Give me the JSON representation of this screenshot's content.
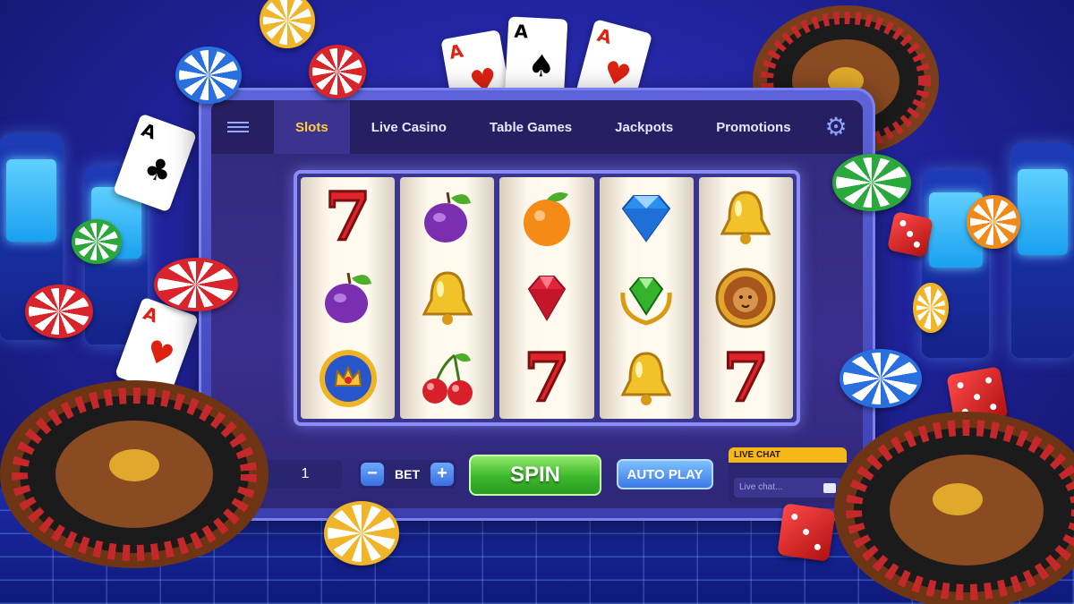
{
  "nav": {
    "menu_icon": "hamburger-menu-icon",
    "tabs": [
      {
        "label": "Slots",
        "active": true
      },
      {
        "label": "Live Casino",
        "active": false
      },
      {
        "label": "Table Games",
        "active": false
      },
      {
        "label": "Jackpots",
        "active": false
      },
      {
        "label": "Promotions",
        "active": false
      }
    ],
    "settings_icon": "gear-icon"
  },
  "reels": [
    [
      "seven",
      "plum",
      "crown-badge"
    ],
    [
      "plum",
      "bell",
      "cherries"
    ],
    [
      "orange",
      "ruby",
      "seven"
    ],
    [
      "diamond",
      "emerald-laurel",
      "bell"
    ],
    [
      "bell",
      "lion-medallion",
      "seven"
    ]
  ],
  "controls": {
    "lines_stepper": {
      "minus": "−",
      "value": "1"
    },
    "bet_stepper": {
      "minus": "−",
      "label": "BET",
      "plus": "+"
    },
    "spin_label": "SPIN",
    "autoplay_label": "AUTO PLAY"
  },
  "live_chat": {
    "header": "LIVE CHAT",
    "placeholder": "Live chat..."
  },
  "colors": {
    "active_tab_text": "#ffcf3a",
    "spin_green": "#3cb82c",
    "autoplay_blue": "#3a78e8",
    "chat_header": "#f5b818"
  }
}
